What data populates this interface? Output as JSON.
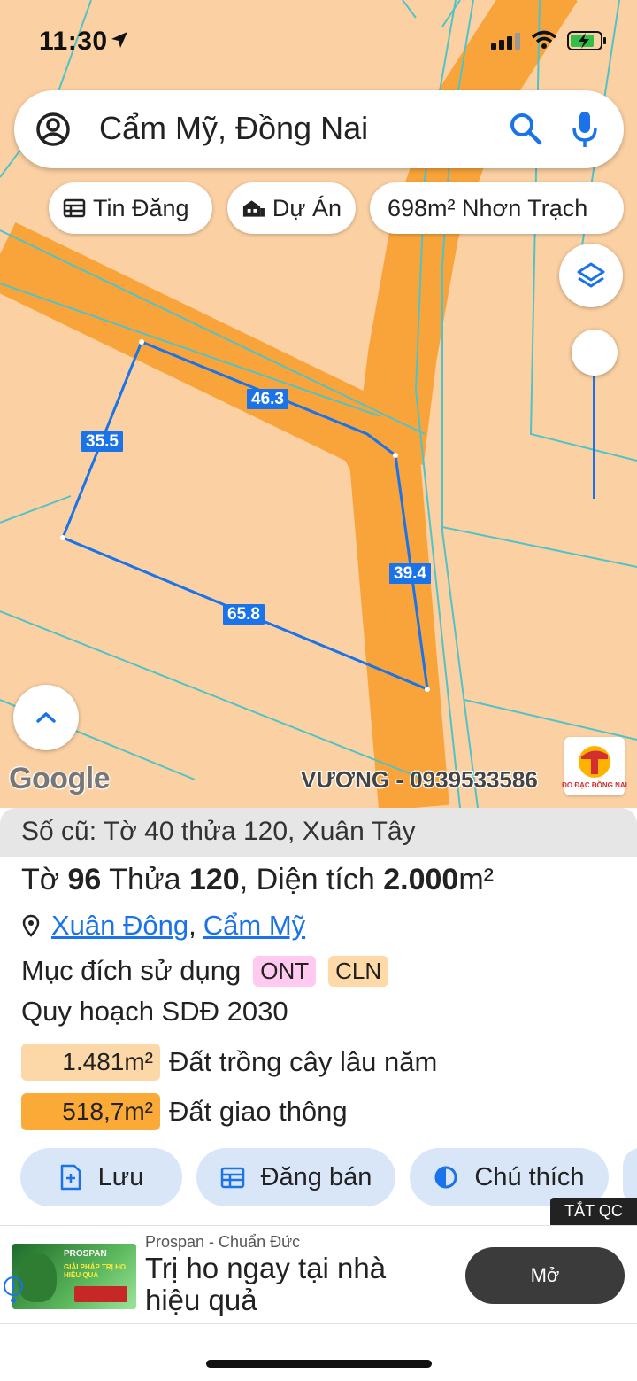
{
  "status_bar": {
    "time": "11:30"
  },
  "search": {
    "query": "Cẩm Mỹ, Đồng Nai"
  },
  "chips": [
    {
      "label": "Tin Đăng",
      "icon": "listing-icon"
    },
    {
      "label": "Dự Án",
      "icon": "building-icon"
    },
    {
      "label": "698m² Nhơn Trạch"
    }
  ],
  "map": {
    "attribution": "Google",
    "watermark": "VƯƠNG - 0939533586",
    "brand_logo_text": "ĐO ĐẠC ĐỒNG NAI",
    "parcel_edge_labels": [
      "46.3",
      "35.5",
      "39.4",
      "65.8"
    ],
    "colors": {
      "land": "#fbd0a2",
      "road": "#f9a43a",
      "parcel_line": "#1a73e8",
      "boundary_line": "#4fc3c8"
    }
  },
  "sheet": {
    "old_info": "Số cũ: Tờ 40 thửa 120, Xuân Tây",
    "parcel": {
      "sheet_label": "Tờ ",
      "sheet_no": "96",
      "plot_label": " Thửa ",
      "plot_no": "120",
      "area_label": ", Diện tích ",
      "area_value": "2.000",
      "area_unit": "m²"
    },
    "address": {
      "ward": "Xuân Đông",
      "separator": ",",
      "district": "Cẩm Mỹ"
    },
    "purpose": {
      "label": "Mục đích sử dụng",
      "codes": [
        "ONT",
        "CLN"
      ]
    },
    "plan_title": "Quy hoạch SDĐ 2030",
    "zones": [
      {
        "area": "1.481m²",
        "name": "Đất trồng cây lâu năm",
        "color": "#fcd7a7"
      },
      {
        "area": "518,7m²",
        "name": "Đất giao thông",
        "color": "#fbaa37"
      }
    ],
    "actions": [
      {
        "label": "Lưu",
        "icon": "save-add-icon"
      },
      {
        "label": "Đăng bán",
        "icon": "calendar-post-icon"
      },
      {
        "label": "Chú thích",
        "icon": "legend-half-circle-icon"
      }
    ]
  },
  "ad": {
    "close_label": "TẮT QC",
    "sponsor": "Prospan - Chuẩn Đức",
    "headline": "Trị ho ngay tại nhà hiệu quả",
    "cta": "Mở",
    "image_text_1": "PROSPAN",
    "image_text_2": "GIẢI PHÁP TRỊ HO HIỆU QUẢ"
  }
}
